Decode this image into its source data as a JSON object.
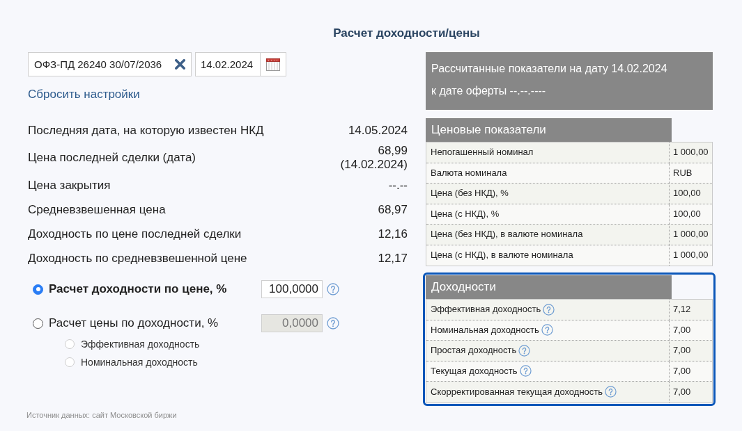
{
  "title": "Расчет доходности/цены",
  "bond_field": {
    "value": "ОФЗ-ПД 26240 30/07/2036"
  },
  "date_field": {
    "value": "14.02.2024"
  },
  "reset_link": "Сбросить настройки",
  "info_rows": [
    {
      "label": "Последняя дата, на которую известен НКД",
      "value": "14.05.2024"
    },
    {
      "label": "Цена последней сделки (дата)",
      "value": "68,99 (14.02.2024)"
    },
    {
      "label": "Цена закрытия",
      "value": "--.--"
    },
    {
      "label": "Средневзвешенная цена",
      "value": "68,97"
    },
    {
      "label": "Доходность по цене последней сделки",
      "value": "12,16"
    },
    {
      "label": "Доходность по средневзвешенной цене",
      "value": "12,17"
    }
  ],
  "calc_modes": [
    {
      "label": "Расчет доходности по цене, %",
      "selected": true,
      "input": {
        "value": "100,0000",
        "disabled": false
      }
    },
    {
      "label": "Расчет цены по доходности, %",
      "selected": false,
      "input": {
        "value": "0,0000",
        "disabled": true
      },
      "options": [
        {
          "label": "Эффективная доходность",
          "selected": false,
          "disabled": true
        },
        {
          "label": "Номинальная доходность",
          "selected": false,
          "disabled": true
        }
      ]
    }
  ],
  "source_note": "Источник данных: сайт Московской биржи",
  "summary": {
    "lines": [
      "Рассчитанные показатели на дату 14.02.2024",
      "к дате оферты --.--.----"
    ]
  },
  "tables": [
    {
      "title": "Ценовые показатели",
      "highlighted": false,
      "rows": [
        {
          "label": "Непогашенный номинал",
          "value": "1 000,00",
          "help": false
        },
        {
          "label": "Валюта номинала",
          "value": "RUB",
          "help": false
        },
        {
          "label": "Цена (без НКД), %",
          "value": "100,00",
          "help": false
        },
        {
          "label": "Цена (с НКД), %",
          "value": "100,00",
          "help": false
        },
        {
          "label": "Цена (без НКД), в валюте номинала",
          "value": "1 000,00",
          "help": false
        },
        {
          "label": "Цена (с НКД), в валюте номинала",
          "value": "1 000,00",
          "help": false
        }
      ]
    },
    {
      "title": "Доходности",
      "highlighted": true,
      "rows": [
        {
          "label": "Эффективная доходность",
          "value": "7,12",
          "help": true
        },
        {
          "label": "Номинальная доходность",
          "value": "7,00",
          "help": true
        },
        {
          "label": "Простая доходность",
          "value": "7,00",
          "help": true
        },
        {
          "label": "Текущая доходность",
          "value": "7,00",
          "help": true
        },
        {
          "label": "Скорректированная текущая доходность",
          "value": "7,00",
          "help": true
        }
      ]
    }
  ]
}
